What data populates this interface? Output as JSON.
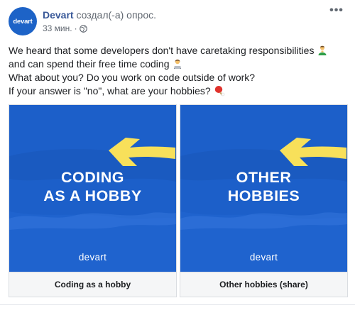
{
  "post": {
    "author": "Devart",
    "action": "создал(-а) опрос.",
    "time": "33 мин.",
    "separator": "·",
    "avatar_text": "devart",
    "more_label": "•••",
    "lines": [
      "We heard that some developers don't have caretaking responsibilities",
      "and can spend their free time coding",
      "What about you? Do you work on code outside of work?",
      "If your answer is \"no\", what are your hobbies?"
    ],
    "icons": {
      "line1": "person-icon",
      "line2": "technologist-icon",
      "line4": "ping-pong-icon",
      "privacy": "globe-icon",
      "more": "more-options-icon"
    }
  },
  "poll": {
    "options": [
      {
        "title_lines": [
          "CODING",
          "AS A HOBBY"
        ],
        "brand": "devart",
        "label": "Coding as a hobby"
      },
      {
        "title_lines": [
          "OTHER",
          "HOBBIES"
        ],
        "brand": "devart",
        "label": "Other hobbies (share)"
      }
    ]
  },
  "colors": {
    "brand_blue": "#1c5fc9",
    "arrow_yellow": "#f8e05a",
    "link": "#385898"
  }
}
